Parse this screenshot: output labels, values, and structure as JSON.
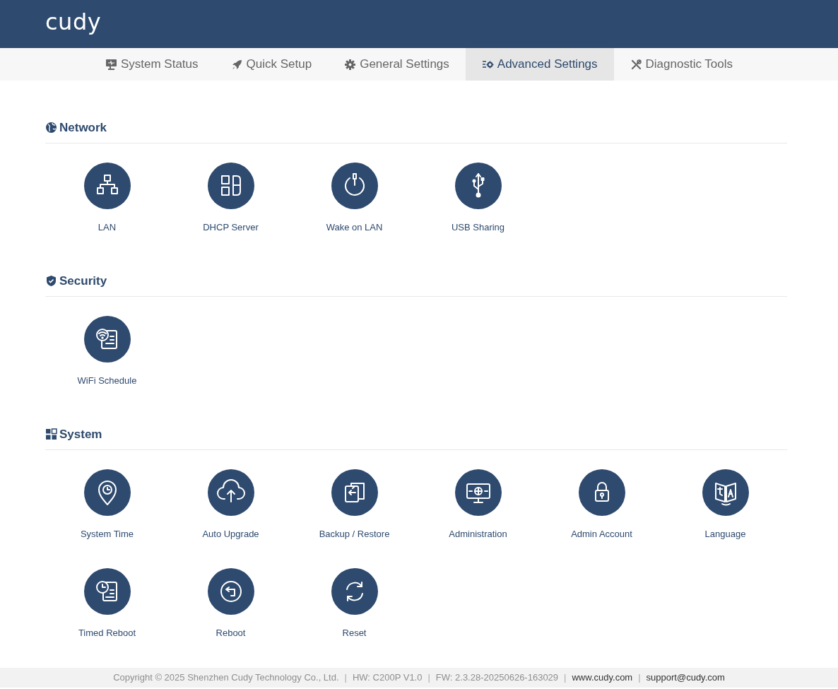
{
  "header": {
    "logo": "cudy"
  },
  "tabs": [
    {
      "label": "System Status",
      "selected": false
    },
    {
      "label": "Quick Setup",
      "selected": false
    },
    {
      "label": "General Settings",
      "selected": false
    },
    {
      "label": "Advanced Settings",
      "selected": true
    },
    {
      "label": "Diagnostic Tools",
      "selected": false
    }
  ],
  "sections": [
    {
      "title": "Network",
      "items": [
        {
          "label": "LAN"
        },
        {
          "label": "DHCP Server"
        },
        {
          "label": "Wake on LAN"
        },
        {
          "label": "USB Sharing"
        }
      ]
    },
    {
      "title": "Security",
      "items": [
        {
          "label": "WiFi Schedule"
        }
      ]
    },
    {
      "title": "System",
      "items": [
        {
          "label": "System Time"
        },
        {
          "label": "Auto Upgrade"
        },
        {
          "label": "Backup / Restore"
        },
        {
          "label": "Administration"
        },
        {
          "label": "Admin Account"
        },
        {
          "label": "Language"
        },
        {
          "label": "Timed Reboot"
        },
        {
          "label": "Reboot"
        },
        {
          "label": "Reset"
        }
      ]
    }
  ],
  "footer": [
    {
      "kind": "info",
      "text": "Copyright © 2025 Shenzhen Cudy Technology Co., Ltd."
    },
    {
      "kind": "separator",
      "text": "|"
    },
    {
      "kind": "info",
      "text": "HW: C200P V1.0"
    },
    {
      "kind": "separator",
      "text": "|"
    },
    {
      "kind": "info",
      "text": "FW: 2.3.28-20250626-163029"
    },
    {
      "kind": "separator",
      "text": "|"
    },
    {
      "kind": "link",
      "text": "www.cudy.com"
    },
    {
      "kind": "separator",
      "text": "|"
    },
    {
      "kind": "link",
      "text": "support@cudy.com"
    }
  ]
}
